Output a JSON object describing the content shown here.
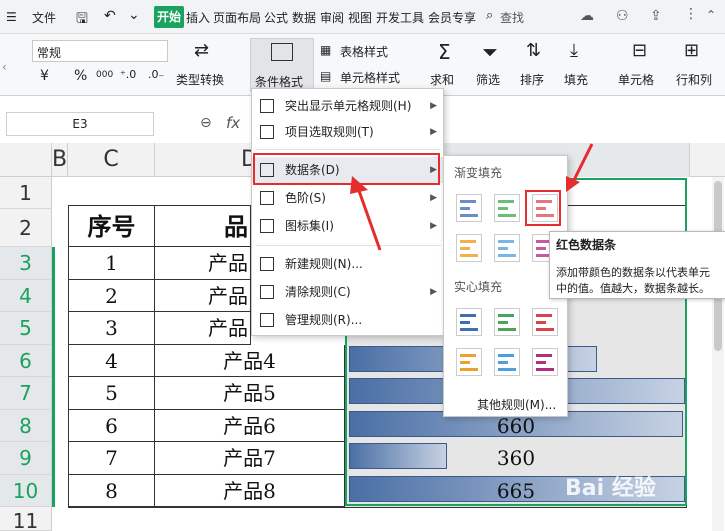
{
  "menubar": {
    "file": "文件",
    "tabs": [
      "开始",
      "插入",
      "页面布局",
      "公式",
      "数据",
      "审阅",
      "视图",
      "开发工具",
      "会员专享"
    ],
    "search": "查找"
  },
  "ribbon": {
    "number_format": "常规",
    "currency_symbol": "¥",
    "percent_symbol": "%",
    "thousands_symbol": "000",
    "type_convert": "类型转换",
    "cond_format": "条件格式",
    "table_style": "表格样式",
    "cell_style": "单元格样式",
    "sum": "求和",
    "filter": "筛选",
    "sort": "排序",
    "fill": "填充",
    "cell": "单元格",
    "row_col": "行和列"
  },
  "formula_bar": {
    "name_box": "E3",
    "fx": "fx"
  },
  "columns": [
    "B",
    "C",
    "D"
  ],
  "row_numbers": [
    "1",
    "2",
    "3",
    "4",
    "5",
    "6",
    "7",
    "8",
    "9",
    "10",
    "11"
  ],
  "table": {
    "header_no": "序号",
    "header_product": "品",
    "rows": [
      {
        "no": "1",
        "product": "产品"
      },
      {
        "no": "2",
        "product": "产品"
      },
      {
        "no": "3",
        "product": "产品"
      },
      {
        "no": "4",
        "product": "产品4"
      },
      {
        "no": "5",
        "product": "产品5"
      },
      {
        "no": "6",
        "product": "产品6",
        "value": "660"
      },
      {
        "no": "7",
        "product": "产品7",
        "value": "360"
      },
      {
        "no": "8",
        "product": "产品8",
        "value": "665"
      }
    ]
  },
  "cf_menu": {
    "items": [
      "突出显示单元格规则(H)",
      "项目选取规则(T)",
      "数据条(D)",
      "色阶(S)",
      "图标集(I)",
      "新建规则(N)...",
      "清除规则(C)",
      "管理规则(R)..."
    ]
  },
  "databar_sub": {
    "gradient": "渐变填充",
    "solid": "实心填充",
    "other": "其他规则(M)..."
  },
  "tooltip": {
    "title": "红色数据条",
    "line1": "添加带颜色的数据条以代表单元",
    "line2": "中的值。值越大，数据条越长。"
  },
  "watermark": "Bai 经验",
  "colors": {
    "accent": "#1aa260",
    "highlight": "#e52d2d",
    "bar": "#4a6fa5"
  }
}
